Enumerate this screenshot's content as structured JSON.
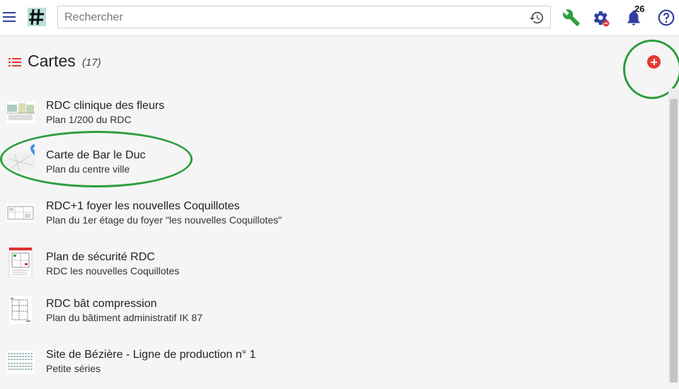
{
  "topbar": {
    "search_placeholder": "Rechercher",
    "notification_count": "26"
  },
  "page": {
    "title": "Cartes",
    "count": "(17)"
  },
  "cards": [
    {
      "title": "RDC clinique des fleurs",
      "subtitle": "Plan 1/200 du RDC"
    },
    {
      "title": "Carte de Bar le Duc",
      "subtitle": "Plan du centre ville"
    },
    {
      "title": "RDC+1 foyer les nouvelles Coquillotes",
      "subtitle": "Plan du 1er étage du foyer \"les nouvelles Coquillotes\""
    },
    {
      "title": "Plan de sécurité RDC",
      "subtitle": "RDC les nouvelles Coquillotes"
    },
    {
      "title": "RDC bât compression",
      "subtitle": "Plan du bâtiment administratif IK 87"
    },
    {
      "title": "Site de Bézière - Ligne de production n° 1",
      "subtitle": "Petite séries"
    }
  ],
  "colors": {
    "accent": "#303f9f",
    "add_button": "#e53935",
    "wrench": "#2e9e3e",
    "highlight": "#2e9e3e"
  },
  "icons": [
    "menu-icon",
    "logo-icon",
    "history-icon",
    "wrench-icon",
    "settings-icon",
    "bell-icon",
    "help-icon",
    "list-icon",
    "add-icon",
    "location-pin-icon"
  ]
}
